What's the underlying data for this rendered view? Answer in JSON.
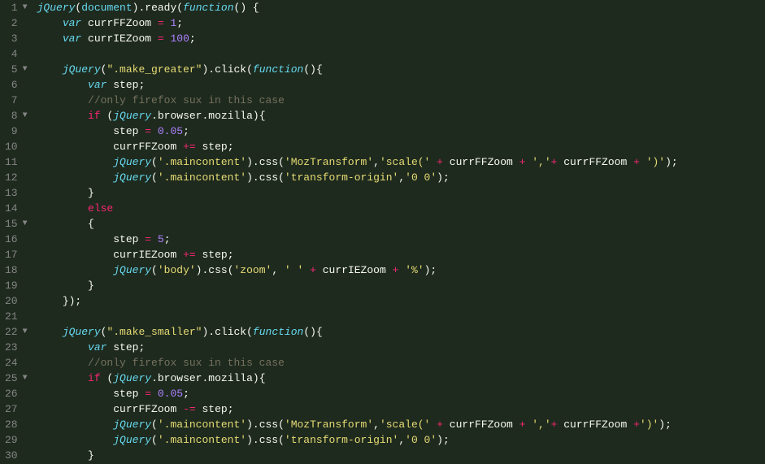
{
  "gutter": [
    {
      "n": "1",
      "f": "▼"
    },
    {
      "n": "2",
      "f": ""
    },
    {
      "n": "3",
      "f": ""
    },
    {
      "n": "4",
      "f": ""
    },
    {
      "n": "5",
      "f": "▼"
    },
    {
      "n": "6",
      "f": ""
    },
    {
      "n": "7",
      "f": ""
    },
    {
      "n": "8",
      "f": "▼"
    },
    {
      "n": "9",
      "f": ""
    },
    {
      "n": "10",
      "f": ""
    },
    {
      "n": "11",
      "f": ""
    },
    {
      "n": "12",
      "f": ""
    },
    {
      "n": "13",
      "f": ""
    },
    {
      "n": "14",
      "f": ""
    },
    {
      "n": "15",
      "f": "▼"
    },
    {
      "n": "16",
      "f": ""
    },
    {
      "n": "17",
      "f": ""
    },
    {
      "n": "18",
      "f": ""
    },
    {
      "n": "19",
      "f": ""
    },
    {
      "n": "20",
      "f": ""
    },
    {
      "n": "21",
      "f": ""
    },
    {
      "n": "22",
      "f": "▼"
    },
    {
      "n": "23",
      "f": ""
    },
    {
      "n": "24",
      "f": ""
    },
    {
      "n": "25",
      "f": "▼"
    },
    {
      "n": "26",
      "f": ""
    },
    {
      "n": "27",
      "f": ""
    },
    {
      "n": "28",
      "f": ""
    },
    {
      "n": "29",
      "f": ""
    },
    {
      "n": "30",
      "f": ""
    }
  ],
  "lines": [
    [
      {
        "c": "t-func-ital",
        "t": "jQuery"
      },
      {
        "c": "t-punc",
        "t": "("
      },
      {
        "c": "t-cyan",
        "t": "document"
      },
      {
        "c": "t-punc",
        "t": ")."
      },
      {
        "c": "t-white",
        "t": "ready"
      },
      {
        "c": "t-punc",
        "t": "("
      },
      {
        "c": "t-keyword",
        "t": "function"
      },
      {
        "c": "t-punc",
        "t": "() {"
      }
    ],
    [
      {
        "c": "",
        "t": "    "
      },
      {
        "c": "t-keyword",
        "t": "var"
      },
      {
        "c": "t-white",
        "t": " currFFZoom "
      },
      {
        "c": "t-op",
        "t": "="
      },
      {
        "c": "t-white",
        "t": " "
      },
      {
        "c": "t-num",
        "t": "1"
      },
      {
        "c": "t-punc",
        "t": ";"
      }
    ],
    [
      {
        "c": "",
        "t": "    "
      },
      {
        "c": "t-keyword",
        "t": "var"
      },
      {
        "c": "t-white",
        "t": " currIEZoom "
      },
      {
        "c": "t-op",
        "t": "="
      },
      {
        "c": "t-white",
        "t": " "
      },
      {
        "c": "t-num",
        "t": "100"
      },
      {
        "c": "t-punc",
        "t": ";"
      }
    ],
    [
      {
        "c": "",
        "t": " "
      }
    ],
    [
      {
        "c": "",
        "t": "    "
      },
      {
        "c": "t-func-ital",
        "t": "jQuery"
      },
      {
        "c": "t-punc",
        "t": "("
      },
      {
        "c": "t-str",
        "t": "\".make_greater\""
      },
      {
        "c": "t-punc",
        "t": ")."
      },
      {
        "c": "t-white",
        "t": "click"
      },
      {
        "c": "t-punc",
        "t": "("
      },
      {
        "c": "t-keyword",
        "t": "function"
      },
      {
        "c": "t-punc",
        "t": "(){"
      }
    ],
    [
      {
        "c": "",
        "t": "        "
      },
      {
        "c": "t-keyword",
        "t": "var"
      },
      {
        "c": "t-white",
        "t": " step"
      },
      {
        "c": "t-punc",
        "t": ";"
      }
    ],
    [
      {
        "c": "",
        "t": "        "
      },
      {
        "c": "t-comment",
        "t": "//only firefox sux in this case"
      }
    ],
    [
      {
        "c": "",
        "t": "        "
      },
      {
        "c": "t-kw-red",
        "t": "if"
      },
      {
        "c": "t-punc",
        "t": " ("
      },
      {
        "c": "t-func-ital",
        "t": "jQuery"
      },
      {
        "c": "t-punc",
        "t": "."
      },
      {
        "c": "t-white",
        "t": "browser"
      },
      {
        "c": "t-punc",
        "t": "."
      },
      {
        "c": "t-white",
        "t": "mozilla"
      },
      {
        "c": "t-punc",
        "t": "){"
      }
    ],
    [
      {
        "c": "",
        "t": "            "
      },
      {
        "c": "t-white",
        "t": "step "
      },
      {
        "c": "t-op",
        "t": "="
      },
      {
        "c": "t-white",
        "t": " "
      },
      {
        "c": "t-num",
        "t": "0.05"
      },
      {
        "c": "t-punc",
        "t": ";"
      }
    ],
    [
      {
        "c": "",
        "t": "            "
      },
      {
        "c": "t-white",
        "t": "currFFZoom "
      },
      {
        "c": "t-op",
        "t": "+="
      },
      {
        "c": "t-white",
        "t": " step"
      },
      {
        "c": "t-punc",
        "t": ";"
      }
    ],
    [
      {
        "c": "",
        "t": "            "
      },
      {
        "c": "t-func-ital",
        "t": "jQuery"
      },
      {
        "c": "t-punc",
        "t": "("
      },
      {
        "c": "t-str",
        "t": "'.maincontent'"
      },
      {
        "c": "t-punc",
        "t": ")."
      },
      {
        "c": "t-white",
        "t": "css"
      },
      {
        "c": "t-punc",
        "t": "("
      },
      {
        "c": "t-str",
        "t": "'MozTransform'"
      },
      {
        "c": "t-punc",
        "t": ","
      },
      {
        "c": "t-str",
        "t": "'scale('"
      },
      {
        "c": "t-white",
        "t": " "
      },
      {
        "c": "t-op",
        "t": "+"
      },
      {
        "c": "t-white",
        "t": " currFFZoom "
      },
      {
        "c": "t-op",
        "t": "+"
      },
      {
        "c": "t-white",
        "t": " "
      },
      {
        "c": "t-str",
        "t": "','"
      },
      {
        "c": "t-op",
        "t": "+"
      },
      {
        "c": "t-white",
        "t": " currFFZoom "
      },
      {
        "c": "t-op",
        "t": "+"
      },
      {
        "c": "t-white",
        "t": " "
      },
      {
        "c": "t-str",
        "t": "')'"
      },
      {
        "c": "t-punc",
        "t": ");"
      }
    ],
    [
      {
        "c": "",
        "t": "            "
      },
      {
        "c": "t-func-ital",
        "t": "jQuery"
      },
      {
        "c": "t-punc",
        "t": "("
      },
      {
        "c": "t-str",
        "t": "'.maincontent'"
      },
      {
        "c": "t-punc",
        "t": ")."
      },
      {
        "c": "t-white",
        "t": "css"
      },
      {
        "c": "t-punc",
        "t": "("
      },
      {
        "c": "t-str",
        "t": "'transform-origin'"
      },
      {
        "c": "t-punc",
        "t": ","
      },
      {
        "c": "t-str",
        "t": "'0 0'"
      },
      {
        "c": "t-punc",
        "t": ");"
      }
    ],
    [
      {
        "c": "",
        "t": "        "
      },
      {
        "c": "t-punc",
        "t": "}"
      }
    ],
    [
      {
        "c": "",
        "t": "        "
      },
      {
        "c": "t-kw-red",
        "t": "else"
      }
    ],
    [
      {
        "c": "",
        "t": "        "
      },
      {
        "c": "t-punc",
        "t": "{"
      }
    ],
    [
      {
        "c": "",
        "t": "            "
      },
      {
        "c": "t-white",
        "t": "step "
      },
      {
        "c": "t-op",
        "t": "="
      },
      {
        "c": "t-white",
        "t": " "
      },
      {
        "c": "t-num",
        "t": "5"
      },
      {
        "c": "t-punc",
        "t": ";"
      }
    ],
    [
      {
        "c": "",
        "t": "            "
      },
      {
        "c": "t-white",
        "t": "currIEZoom "
      },
      {
        "c": "t-op",
        "t": "+="
      },
      {
        "c": "t-white",
        "t": " step"
      },
      {
        "c": "t-punc",
        "t": ";"
      }
    ],
    [
      {
        "c": "",
        "t": "            "
      },
      {
        "c": "t-func-ital",
        "t": "jQuery"
      },
      {
        "c": "t-punc",
        "t": "("
      },
      {
        "c": "t-str",
        "t": "'body'"
      },
      {
        "c": "t-punc",
        "t": ")."
      },
      {
        "c": "t-white",
        "t": "css"
      },
      {
        "c": "t-punc",
        "t": "("
      },
      {
        "c": "t-str",
        "t": "'zoom'"
      },
      {
        "c": "t-punc",
        "t": ", "
      },
      {
        "c": "t-str",
        "t": "' '"
      },
      {
        "c": "t-white",
        "t": " "
      },
      {
        "c": "t-op",
        "t": "+"
      },
      {
        "c": "t-white",
        "t": " currIEZoom "
      },
      {
        "c": "t-op",
        "t": "+"
      },
      {
        "c": "t-white",
        "t": " "
      },
      {
        "c": "t-str",
        "t": "'%'"
      },
      {
        "c": "t-punc",
        "t": ");"
      }
    ],
    [
      {
        "c": "",
        "t": "        "
      },
      {
        "c": "t-punc",
        "t": "}"
      }
    ],
    [
      {
        "c": "",
        "t": "    "
      },
      {
        "c": "t-punc",
        "t": "});"
      }
    ],
    [
      {
        "c": "",
        "t": " "
      }
    ],
    [
      {
        "c": "",
        "t": "    "
      },
      {
        "c": "t-func-ital",
        "t": "jQuery"
      },
      {
        "c": "t-punc",
        "t": "("
      },
      {
        "c": "t-str",
        "t": "\".make_smaller\""
      },
      {
        "c": "t-punc",
        "t": ")."
      },
      {
        "c": "t-white",
        "t": "click"
      },
      {
        "c": "t-punc",
        "t": "("
      },
      {
        "c": "t-keyword",
        "t": "function"
      },
      {
        "c": "t-punc",
        "t": "(){"
      }
    ],
    [
      {
        "c": "",
        "t": "        "
      },
      {
        "c": "t-keyword",
        "t": "var"
      },
      {
        "c": "t-white",
        "t": " step"
      },
      {
        "c": "t-punc",
        "t": ";"
      }
    ],
    [
      {
        "c": "",
        "t": "        "
      },
      {
        "c": "t-comment",
        "t": "//only firefox sux in this case"
      }
    ],
    [
      {
        "c": "",
        "t": "        "
      },
      {
        "c": "t-kw-red",
        "t": "if"
      },
      {
        "c": "t-punc",
        "t": " ("
      },
      {
        "c": "t-func-ital",
        "t": "jQuery"
      },
      {
        "c": "t-punc",
        "t": "."
      },
      {
        "c": "t-white",
        "t": "browser"
      },
      {
        "c": "t-punc",
        "t": "."
      },
      {
        "c": "t-white",
        "t": "mozilla"
      },
      {
        "c": "t-punc",
        "t": "){"
      }
    ],
    [
      {
        "c": "",
        "t": "            "
      },
      {
        "c": "t-white",
        "t": "step "
      },
      {
        "c": "t-op",
        "t": "="
      },
      {
        "c": "t-white",
        "t": " "
      },
      {
        "c": "t-num",
        "t": "0.05"
      },
      {
        "c": "t-punc",
        "t": ";"
      }
    ],
    [
      {
        "c": "",
        "t": "            "
      },
      {
        "c": "t-white",
        "t": "currFFZoom "
      },
      {
        "c": "t-op",
        "t": "-="
      },
      {
        "c": "t-white",
        "t": " step"
      },
      {
        "c": "t-punc",
        "t": ";"
      }
    ],
    [
      {
        "c": "",
        "t": "            "
      },
      {
        "c": "t-func-ital",
        "t": "jQuery"
      },
      {
        "c": "t-punc",
        "t": "("
      },
      {
        "c": "t-str",
        "t": "'.maincontent'"
      },
      {
        "c": "t-punc",
        "t": ")."
      },
      {
        "c": "t-white",
        "t": "css"
      },
      {
        "c": "t-punc",
        "t": "("
      },
      {
        "c": "t-str",
        "t": "'MozTransform'"
      },
      {
        "c": "t-punc",
        "t": ","
      },
      {
        "c": "t-str",
        "t": "'scale('"
      },
      {
        "c": "t-white",
        "t": " "
      },
      {
        "c": "t-op",
        "t": "+"
      },
      {
        "c": "t-white",
        "t": " currFFZoom "
      },
      {
        "c": "t-op",
        "t": "+"
      },
      {
        "c": "t-white",
        "t": " "
      },
      {
        "c": "t-str",
        "t": "','"
      },
      {
        "c": "t-op",
        "t": "+"
      },
      {
        "c": "t-white",
        "t": " currFFZoom "
      },
      {
        "c": "t-op",
        "t": "+"
      },
      {
        "c": "t-str",
        "t": "')'"
      },
      {
        "c": "t-punc",
        "t": ");"
      }
    ],
    [
      {
        "c": "",
        "t": "            "
      },
      {
        "c": "t-func-ital",
        "t": "jQuery"
      },
      {
        "c": "t-punc",
        "t": "("
      },
      {
        "c": "t-str",
        "t": "'.maincontent'"
      },
      {
        "c": "t-punc",
        "t": ")."
      },
      {
        "c": "t-white",
        "t": "css"
      },
      {
        "c": "t-punc",
        "t": "("
      },
      {
        "c": "t-str",
        "t": "'transform-origin'"
      },
      {
        "c": "t-punc",
        "t": ","
      },
      {
        "c": "t-str",
        "t": "'0 0'"
      },
      {
        "c": "t-punc",
        "t": ");"
      }
    ],
    [
      {
        "c": "",
        "t": "        "
      },
      {
        "c": "t-punc",
        "t": "}"
      }
    ]
  ]
}
